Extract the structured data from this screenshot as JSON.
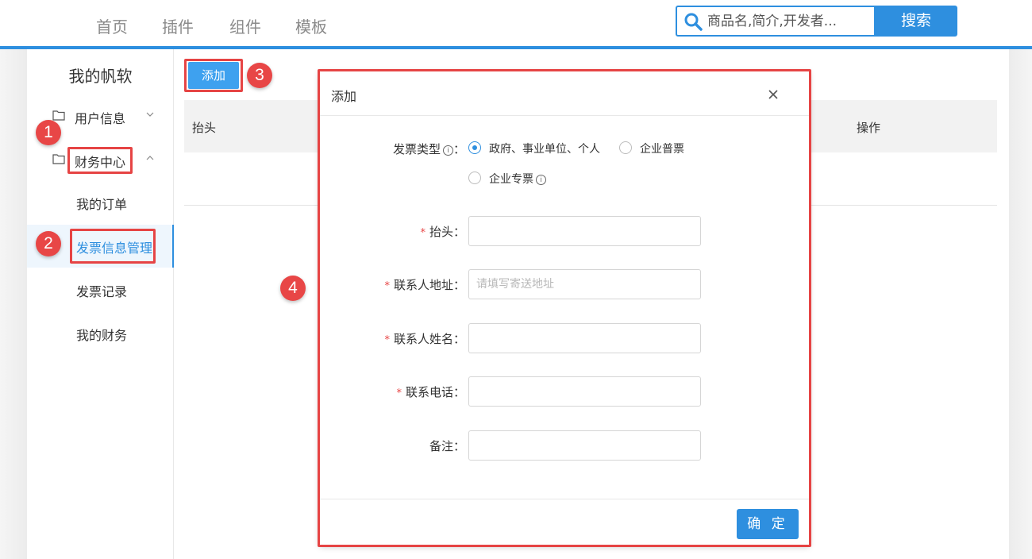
{
  "nav": {
    "items": [
      "首页",
      "插件",
      "组件",
      "模板"
    ],
    "search_placeholder": "商品名,简介,开发者...",
    "search_button": "搜索"
  },
  "sidebar": {
    "title": "我的帆软",
    "groups": [
      {
        "label": "用户信息",
        "expanded": false
      },
      {
        "label": "财务中心",
        "expanded": true
      }
    ],
    "items": [
      {
        "label": "我的订单",
        "active": false
      },
      {
        "label": "发票信息管理",
        "active": true
      },
      {
        "label": "发票记录",
        "active": false
      },
      {
        "label": "我的财务",
        "active": false
      }
    ]
  },
  "content": {
    "add_button": "添加",
    "table_columns": [
      "抬头",
      "操作"
    ]
  },
  "annotations": [
    "1",
    "2",
    "3",
    "4"
  ],
  "modal": {
    "title": "添加",
    "invoice_type_label": "发票类型",
    "invoice_type_options": [
      {
        "label": "政府、事业单位、个人",
        "checked": true
      },
      {
        "label": "企业普票",
        "checked": false
      },
      {
        "label": "企业专票",
        "checked": false
      }
    ],
    "fields": [
      {
        "label": "抬头",
        "required": true,
        "placeholder": "",
        "value": ""
      },
      {
        "label": "联系人地址",
        "required": true,
        "placeholder": "请填写寄送地址",
        "value": ""
      },
      {
        "label": "联系人姓名",
        "required": true,
        "placeholder": "",
        "value": ""
      },
      {
        "label": "联系电话",
        "required": true,
        "placeholder": "",
        "value": ""
      },
      {
        "label": "备注",
        "required": false,
        "placeholder": "",
        "value": ""
      }
    ],
    "colon": "：",
    "confirm_button": "确 定"
  },
  "colors": {
    "accent": "#2e8fdf",
    "annotation_red": "#e64444"
  }
}
